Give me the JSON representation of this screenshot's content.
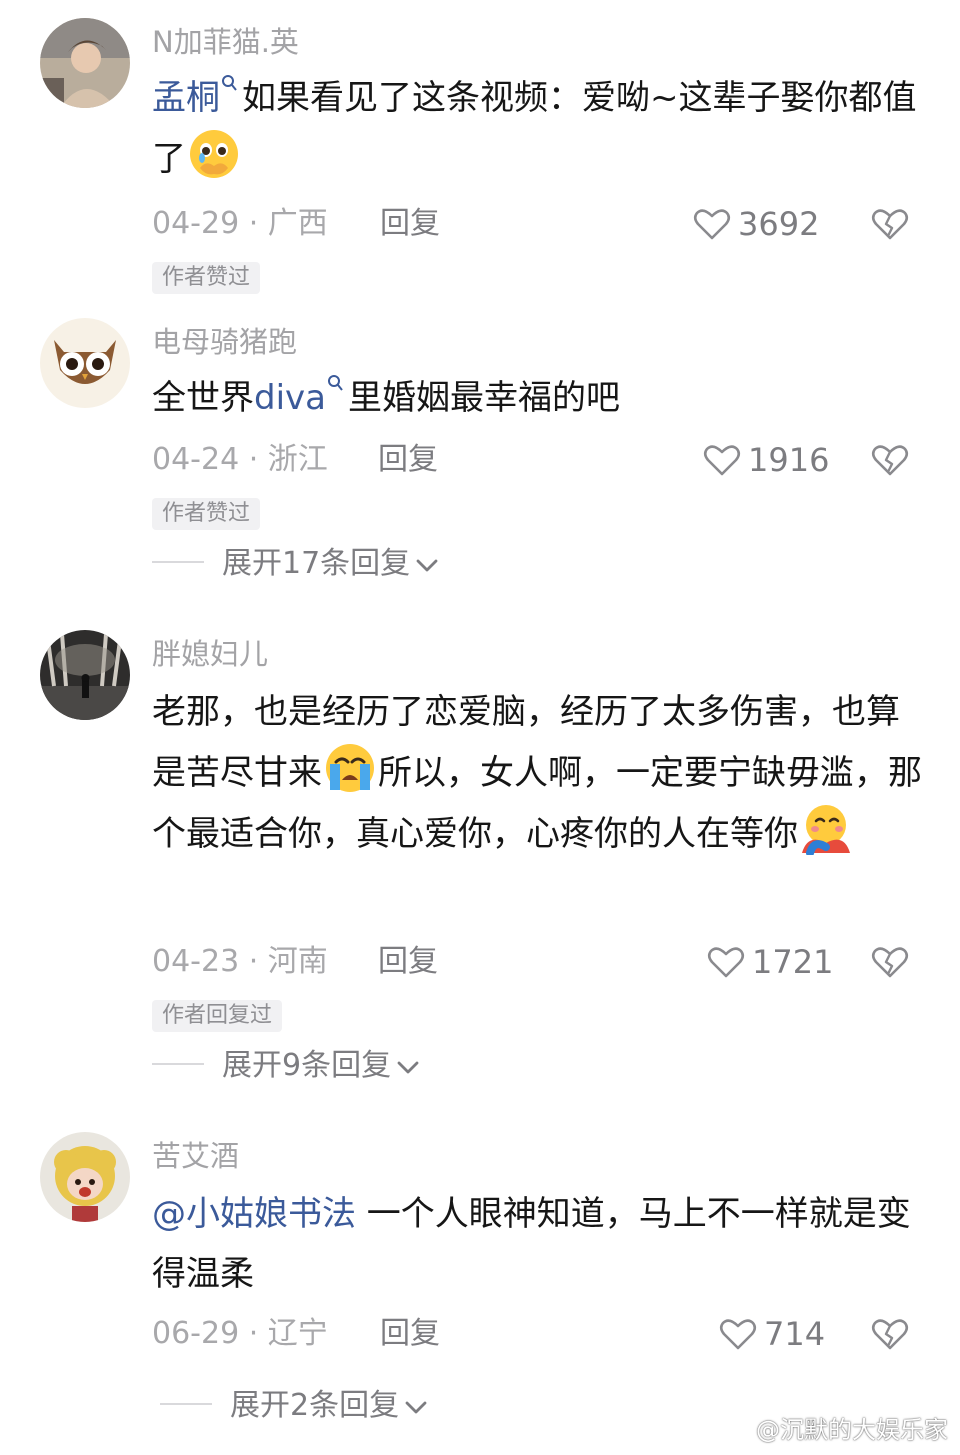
{
  "comments": [
    {
      "username": "N加菲猫.英",
      "mention": "孟桐",
      "text_before_emoji": "如果看见了这条视频：爱呦~这辈子娶你都值了",
      "date_location": "04-29 · 广西",
      "reply_label": "回复",
      "like_count": "3692",
      "badge": "作者赞过",
      "expand": ""
    },
    {
      "username": "电母骑猪跑",
      "text_prefix": "全世界",
      "mention": "diva",
      "text_suffix": "里婚姻最幸福的吧",
      "date_location": "04-24 · 浙江",
      "reply_label": "回复",
      "like_count": "1916",
      "badge": "作者赞过",
      "expand": "展开17条回复"
    },
    {
      "username": "胖媳妇儿",
      "text_part1": "老那，也是经历了恋爱脑，经历了太多伤害，也算是苦尽甘来",
      "text_part2": "所以，女人啊，一定要宁缺毋滥，那个最适合你，真心爱你，心疼你的人在等你",
      "date_location": "04-23 · 河南",
      "reply_label": "回复",
      "like_count": "1721",
      "badge": "作者回复过",
      "expand": "展开9条回复"
    },
    {
      "username": "苦艾酒",
      "mention": "@小姑娘书法",
      "text": " 一个人眼神知道，马上不一样就是变得温柔",
      "date_location": "06-29 · 辽宁",
      "reply_label": "回复",
      "like_count": "714",
      "badge": "",
      "expand": "展开2条回复"
    }
  ],
  "watermark": "@沉默的大娱乐家",
  "colors": {
    "link": "#3b5a9a",
    "meta": "#a8a8ab",
    "action": "#7c7c80",
    "badge_bg": "#f1f1f3"
  },
  "icons": [
    "heart-outline-icon",
    "broken-heart-icon",
    "chevron-down-icon",
    "search-mark-icon",
    "weibo-logo-icon"
  ]
}
